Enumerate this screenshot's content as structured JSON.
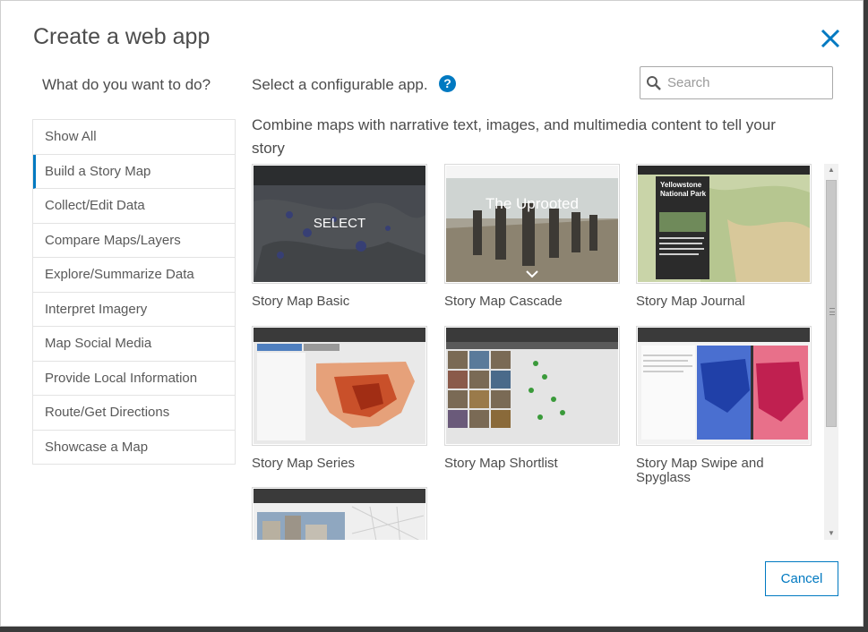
{
  "dialog": {
    "title": "Create a web app",
    "close_icon": "close-icon",
    "left_heading": "What do you want to do?",
    "gallery_heading": "Select a configurable app.",
    "help_glyph": "?",
    "search": {
      "placeholder": "Search",
      "value": ""
    },
    "description": "Combine maps with narrative text, images, and multimedia content to tell your story",
    "cancel_label": "Cancel",
    "accent_color": "#0079c1"
  },
  "categories": [
    {
      "label": "Show All",
      "active": false
    },
    {
      "label": "Build a Story Map",
      "active": true
    },
    {
      "label": "Collect/Edit Data",
      "active": false
    },
    {
      "label": "Compare Maps/Layers",
      "active": false
    },
    {
      "label": "Explore/Summarize Data",
      "active": false
    },
    {
      "label": "Interpret Imagery",
      "active": false
    },
    {
      "label": "Map Social Media",
      "active": false
    },
    {
      "label": "Provide Local Information",
      "active": false
    },
    {
      "label": "Route/Get Directions",
      "active": false
    },
    {
      "label": "Showcase a Map",
      "active": false
    }
  ],
  "apps": [
    {
      "label": "Story Map Basic",
      "overlay": "SELECT"
    },
    {
      "label": "Story Map Cascade",
      "thumb_title": "The Uprooted"
    },
    {
      "label": "Story Map Journal",
      "thumb_title": "Yellowstone National Park"
    },
    {
      "label": "Story Map Series"
    },
    {
      "label": "Story Map Shortlist"
    },
    {
      "label": "Story Map Swipe and Spyglass"
    },
    {
      "label": ""
    }
  ]
}
